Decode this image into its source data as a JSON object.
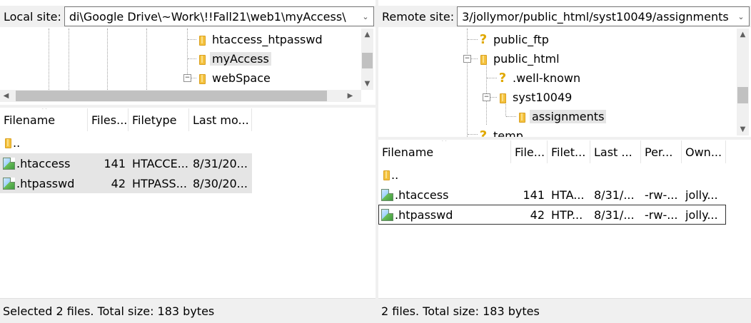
{
  "local": {
    "site_label": "Local site:",
    "site_path": "di\\Google Drive\\~Work\\!!Fall21\\web1\\myAccess\\",
    "tree": [
      {
        "label": "htaccess_htpasswd",
        "icon": "folder-icon",
        "selected": false
      },
      {
        "label": "myAccess",
        "icon": "folder-icon",
        "selected": true
      },
      {
        "label": "webSpace",
        "icon": "folder-icon",
        "selected": false
      }
    ],
    "columns": [
      "Filename",
      "Files...",
      "Filetype",
      "Last mo..."
    ],
    "parent_dir": "..",
    "files": [
      {
        "name": ".htaccess",
        "size": "141",
        "type": "HTACCE...",
        "modified": "8/31/20..."
      },
      {
        "name": ".htpasswd",
        "size": "42",
        "type": "HTPASS...",
        "modified": "8/30/20..."
      }
    ],
    "status": "Selected 2 files. Total size: 183 bytes"
  },
  "remote": {
    "site_label": "Remote site:",
    "site_path": "3/jollymor/public_html/syst10049/assignments",
    "tree": [
      {
        "label": "public_ftp",
        "icon": "question-icon",
        "selected": false
      },
      {
        "label": "public_html",
        "icon": "folder-icon",
        "selected": false
      },
      {
        "label": ".well-known",
        "icon": "question-icon",
        "selected": false
      },
      {
        "label": "syst10049",
        "icon": "folder-icon",
        "selected": false
      },
      {
        "label": "assignments",
        "icon": "folder-icon",
        "selected": true
      },
      {
        "label": "temp",
        "icon": "question-icon",
        "selected": false
      }
    ],
    "columns": [
      "Filename",
      "File...",
      "Filet...",
      "Last ...",
      "Per...",
      "Own..."
    ],
    "parent_dir": "..",
    "files": [
      {
        "name": ".htaccess",
        "size": "141",
        "type": "HTA...",
        "modified": "8/31/...",
        "perms": "-rw-...",
        "owner": "jolly..."
      },
      {
        "name": ".htpasswd",
        "size": "42",
        "type": "HTP...",
        "modified": "8/31/...",
        "perms": "-rw-...",
        "owner": "jolly..."
      }
    ],
    "status": "2 files. Total size: 183 bytes"
  }
}
